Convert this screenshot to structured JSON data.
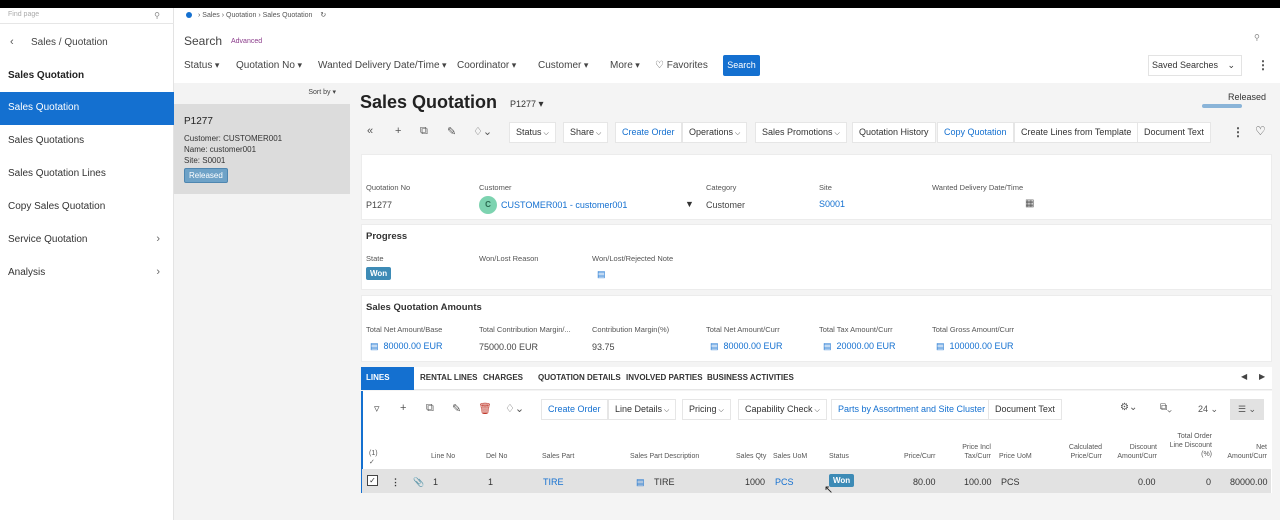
{
  "find": {
    "placeholder": "Find page"
  },
  "nav": {
    "back_title": "Sales / Quotation",
    "heading": "Sales Quotation",
    "items": [
      {
        "label": "Sales Quotation",
        "active": true
      },
      {
        "label": "Sales Quotations"
      },
      {
        "label": "Sales Quotation Lines"
      },
      {
        "label": "Copy Sales Quotation"
      },
      {
        "label": "Service Quotation",
        "expandable": true
      },
      {
        "label": "Analysis",
        "expandable": true
      }
    ]
  },
  "list": {
    "sort_label": "Sort by",
    "card": {
      "title": "P1277",
      "customer": "Customer:  CUSTOMER001",
      "name": "Name:  customer001",
      "site": "Site:  S0001",
      "status": "Released"
    }
  },
  "breadcrumb": {
    "items": [
      "Sales",
      "Quotation",
      "Sales Quotation"
    ]
  },
  "search": {
    "label": "Search",
    "advanced": "Advanced",
    "filters": [
      "Status",
      "Quotation No",
      "Wanted Delivery Date/Time",
      "Coordinator",
      "Customer",
      "More"
    ],
    "favorites": "Favorites",
    "button": "Search",
    "saved": "Saved Searches"
  },
  "page": {
    "title": "Sales Quotation",
    "id": "P1277",
    "status": "Released"
  },
  "toolbar": {
    "status": "Status",
    "share": "Share",
    "create_order": "Create Order",
    "operations": "Operations",
    "promotions": "Sales Promotions",
    "history": "Quotation History",
    "copy": "Copy Quotation",
    "create_lines": "Create Lines from Template",
    "document_text": "Document Text"
  },
  "header": {
    "quotation_no_label": "Quotation No",
    "quotation_no": "P1277",
    "customer_label": "Customer",
    "customer_avatar": "C",
    "customer": "CUSTOMER001 - customer001",
    "category_label": "Category",
    "category": "Customer",
    "site_label": "Site",
    "site": "S0001",
    "wanted_label": "Wanted Delivery Date/Time"
  },
  "progress": {
    "title": "Progress",
    "state_label": "State",
    "state": "Won",
    "reason_label": "Won/Lost Reason",
    "note_label": "Won/Lost/Rejected Note"
  },
  "amounts": {
    "title": "Sales Quotation Amounts",
    "items": [
      {
        "label": "Total Net Amount/Base",
        "value": "80000.00 EUR",
        "link": true
      },
      {
        "label": "Total Contribution Margin/...",
        "value": "75000.00 EUR",
        "link": false
      },
      {
        "label": "Contribution Margin(%)",
        "value": "93.75",
        "link": false
      },
      {
        "label": "Total Net Amount/Curr",
        "value": "80000.00 EUR",
        "link": true
      },
      {
        "label": "Total Tax Amount/Curr",
        "value": "20000.00 EUR",
        "link": true
      },
      {
        "label": "Total Gross Amount/Curr",
        "value": "100000.00 EUR",
        "link": true
      }
    ]
  },
  "tabs": [
    "LINES",
    "RENTAL LINES",
    "CHARGES",
    "QUOTATION DETAILS",
    "INVOLVED PARTIES",
    "BUSINESS ACTIVITIES"
  ],
  "lines_toolbar": {
    "create_order": "Create Order",
    "line_details": "Line Details",
    "pricing": "Pricing",
    "capability": "Capability Check",
    "parts": "Parts by Assortment and Site Cluster",
    "document_text": "Document Text",
    "page_size": "24"
  },
  "table": {
    "selected": "(1)",
    "headers": {
      "line_no": "Line No",
      "del_no": "Del No",
      "sales_part": "Sales Part",
      "description": "Sales Part Description",
      "qty": "Sales Qty",
      "uom": "Sales UoM",
      "status": "Status",
      "price": "Price/Curr",
      "price_incl": [
        "Price Incl",
        "Tax/Curr"
      ],
      "price_uom": "Price UoM",
      "calc_price": [
        "Calculated",
        "Price/Curr"
      ],
      "discount": [
        "Discount",
        "Amount/Curr"
      ],
      "total_disc": [
        "Total Order",
        "Line Discount",
        "(%)"
      ],
      "net": [
        "Net",
        "Amount/Curr"
      ]
    },
    "rows": [
      {
        "line_no": "1",
        "del_no": "1",
        "sales_part": "TIRE",
        "description": "TIRE",
        "qty": "1000",
        "uom": "PCS",
        "status": "Won",
        "price": "80.00",
        "price_incl": "100.00",
        "price_uom": "PCS",
        "discount": "0.00",
        "total_disc": "0",
        "net": "80000.00"
      }
    ]
  }
}
